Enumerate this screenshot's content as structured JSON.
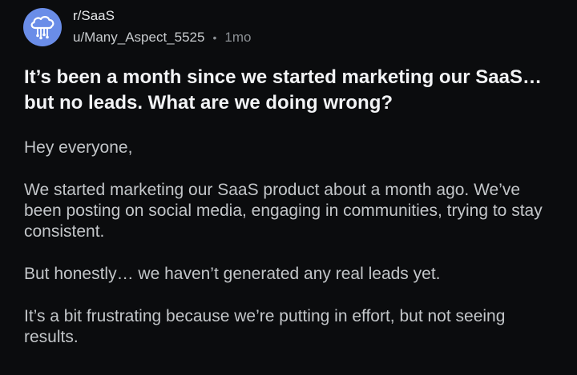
{
  "post": {
    "subreddit": "r/SaaS",
    "author": "u/Many_Aspect_5525",
    "separator": "•",
    "age": "1mo",
    "title": "It’s been a month since we started marketing our SaaS… but no leads. What are we doing wrong?",
    "body": [
      "Hey everyone,",
      "We started marketing our SaaS product about a month ago. We’ve been posting on social media, engaging in communities, trying to stay consistent.",
      "But honestly… we haven’t generated any real leads yet.",
      "It’s a bit frustrating because we’re putting in effort, but not seeing results."
    ]
  },
  "icons": {
    "avatar": "cloud-circuit-icon"
  },
  "colors": {
    "background": "#0b0c0e",
    "avatar": "#6a8de8",
    "title": "#f2f3f5",
    "body_text": "#c3c6c9",
    "muted": "#8b8f93"
  }
}
